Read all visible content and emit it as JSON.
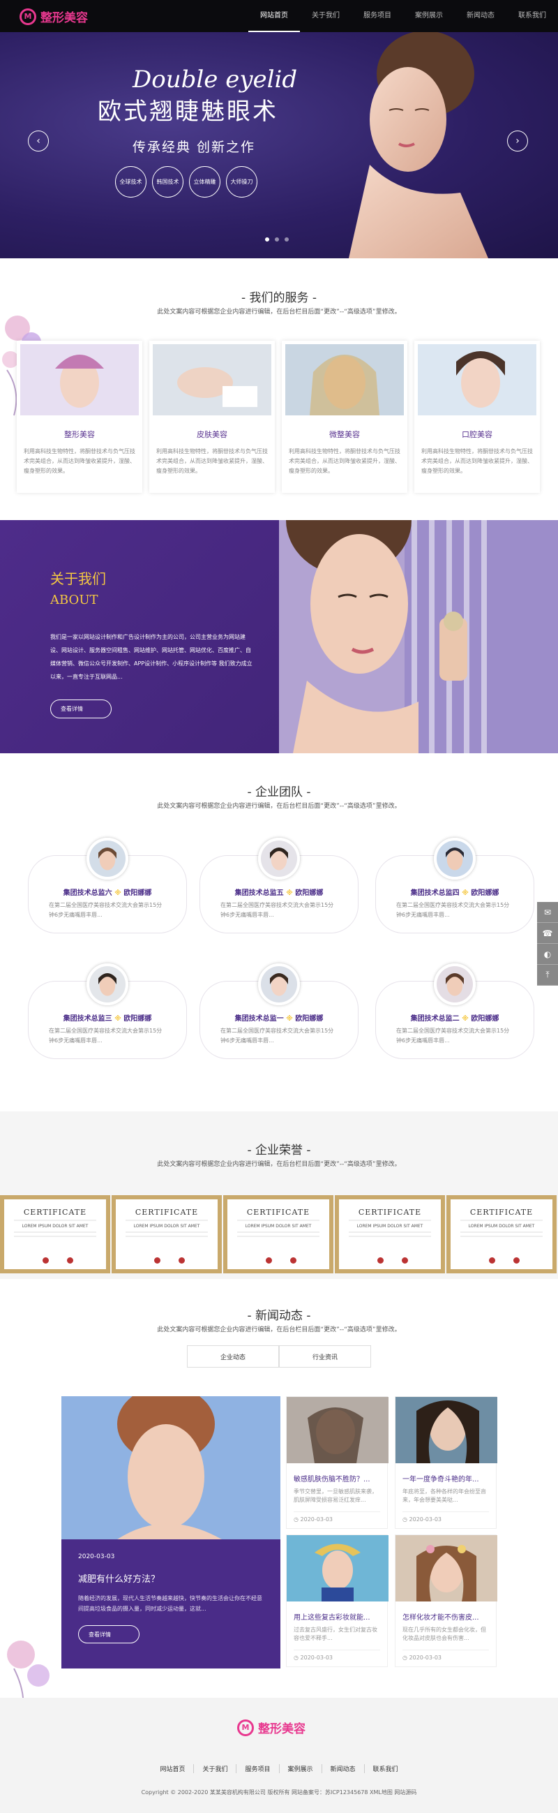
{
  "header": {
    "logo_mark": "M",
    "logo_text": "整形美容",
    "nav": [
      "网站首页",
      "关于我们",
      "服务项目",
      "案例展示",
      "新闻动态",
      "联系我们"
    ]
  },
  "banner": {
    "script": "Double eyelid",
    "title": "欧式翘睫魅眼术",
    "subtitle": "传承经典 创新之作",
    "badges": [
      "全球技术",
      "韩国技术",
      "立体精雕",
      "大师操刀"
    ],
    "prev": "‹",
    "next": "›"
  },
  "services": {
    "title": "- 我们的服务 -",
    "subtitle": "此处文案内容可根据您企业内容进行编辑，在后台栏目后面“更改”--“高级选项”里修改。",
    "items": [
      {
        "title": "整形美容",
        "desc": "利用高科技生物特性，将酮苷技术与负气压技术完美组合，从而达到降皱收紧提升，湿酸、瘦身塑形的效果。"
      },
      {
        "title": "皮肤美容",
        "desc": "利用高科技生物特性，将酮苷技术与负气压技术完美组合，从而达到降皱收紧提升，湿酸、瘦身塑形的效果。"
      },
      {
        "title": "微整美容",
        "desc": "利用高科技生物特性，将酮苷技术与负气压技术完美组合，从而达到降皱收紧提升，湿酸、瘦身塑形的效果。"
      },
      {
        "title": "口腔美容",
        "desc": "利用高科技生物特性，将酮苷技术与负气压技术完美组合，从而达到降皱收紧提升，湿酸、瘦身塑形的效果。"
      }
    ]
  },
  "about": {
    "h1": "关于我们",
    "h2": "ABOUT",
    "text": "我们是一家以网站设计制作和广告设计制作为主的公司，公司主营业务为网站建设、网站设计、服务器空间租售、网站维护、网站托管、网站优化、百度推广、自媒体营销、微信公众号开发制作、APP设计制作、小程序设计制作等 我们致力成立以来，一直专注于互联网品...",
    "button": "查看详情"
  },
  "team": {
    "title": "- 企业团队 -",
    "subtitle": "此处文案内容可根据您企业内容进行编辑，在后台栏目后面“更改”--“高级选项”里修改。",
    "members": [
      {
        "role": "集团技术总监六",
        "name": "欧阳娜娜",
        "desc": "在第二届全国医疗美容技术交流大会第示15分钟6步无痛嘴唇丰唇..."
      },
      {
        "role": "集团技术总监五",
        "name": "欧阳娜娜",
        "desc": "在第二届全国医疗美容技术交流大会第示15分钟6步无痛嘴唇丰唇..."
      },
      {
        "role": "集团技术总监四",
        "name": "欧阳娜娜",
        "desc": "在第二届全国医疗美容技术交流大会第示15分钟6步无痛嘴唇丰唇..."
      },
      {
        "role": "集团技术总监三",
        "name": "欧阳娜娜",
        "desc": "在第二届全国医疗美容技术交流大会第示15分钟6步无痛嘴唇丰唇..."
      },
      {
        "role": "集团技术总监一",
        "name": "欧阳娜娜",
        "desc": "在第二届全国医疗美容技术交流大会第示15分钟6步无痛嘴唇丰唇..."
      },
      {
        "role": "集团技术总监二",
        "name": "欧阳娜娜",
        "desc": "在第二届全国医疗美容技术交流大会第示15分钟6步无痛嘴唇丰唇..."
      }
    ],
    "separator": "※"
  },
  "sidetools": [
    "qq-icon",
    "phone-icon",
    "wechat-icon",
    "top-icon"
  ],
  "honors": {
    "title": "- 企业荣誉 -",
    "subtitle": "此处文案内容可根据您企业内容进行编辑，在后台栏目后面“更改”--“高级选项”里修改。",
    "cert_title": "CERTIFICATE",
    "cert_sub": "LOREM IPSUM DOLOR SIT AMET"
  },
  "news": {
    "title": "- 新闻动态 -",
    "subtitle": "此处文案内容可根据您企业内容进行编辑，在后台栏目后面“更改”--“高级选项”里修改。",
    "tabs": [
      "企业动态",
      "行业资讯"
    ],
    "main": {
      "date": "2020-03-03",
      "title": "减肥有什么好方法？",
      "desc": "随着经济的发展，现代人生活节奏越来越快，快节奏的生活会让你在不经意间提高垃圾食品的摄入量，同时减少运动量，这就...",
      "button": "查看详情"
    },
    "items": [
      {
        "title": "敏感肌肤伤脑不胜防？...",
        "desc": "季节交替里，一旦敏感肌肤来袭，肌肤屏障受损容易泛红发痒...",
        "date": "2020-03-03"
      },
      {
        "title": "一年一度争奇斗艳的年...",
        "desc": "年底将至，各种各样的年会纷至沓来，年会想要美美哒...",
        "date": "2020-03-03"
      },
      {
        "title": "用上这些复古彩妆就能...",
        "desc": "过去复古风盛行，女生们对复古妆容也爱不释手...",
        "date": "2020-03-03"
      },
      {
        "title": "怎样化妆才能不伤害皮...",
        "desc": "现在几乎所有的女生都会化妆，但化妆品对皮肤也会有伤害...",
        "date": "2020-03-03"
      }
    ]
  },
  "footer": {
    "logo_text": "整形美容",
    "nav": [
      "网站首页",
      "关于我们",
      "服务项目",
      "案例展示",
      "新闻动态",
      "联系我们"
    ],
    "copyright": "Copyright © 2002-2020 某某美容机构有限公司 版权所有 网站备案号：苏ICP12345678 XML地图 网站源码"
  },
  "colors": {
    "accent": "#e8388f",
    "purple": "#4a2c88",
    "gold": "#f5c842"
  }
}
